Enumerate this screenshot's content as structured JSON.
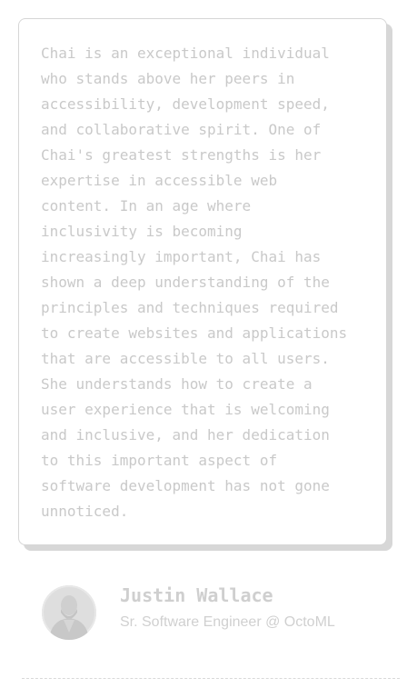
{
  "testimonial": {
    "quote_lines": [
      "Chai is an exceptional individual",
      "who stands above her peers in",
      "accessibility, development speed,",
      "and collaborative spirit. One of",
      "Chai's greatest strengths is her",
      "expertise in accessible web",
      "content. In an age where",
      "inclusivity is becoming",
      "increasingly important, Chai has",
      "shown a deep understanding of the",
      "principles and techniques required",
      "to create websites and applications",
      "that are accessible to all users.",
      "She understands how to create a",
      "user experience that is welcoming",
      "and inclusive, and her dedication",
      "to this important aspect of",
      "software development has not gone",
      "unnoticed."
    ]
  },
  "author": {
    "name": "Justin Wallace",
    "title": "Sr. Software Engineer @ OctoML",
    "avatar_icon": "person-photo-icon"
  },
  "colors": {
    "text": "#c9c9c9",
    "card_border": "#d6d6d6",
    "card_shadow": "#d7d7d7",
    "background": "#ffffff"
  }
}
